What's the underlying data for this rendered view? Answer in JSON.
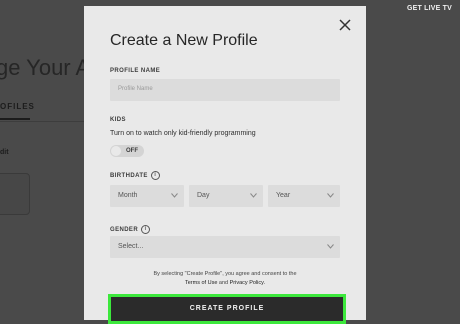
{
  "background": {
    "heading": "ge Your A",
    "tab_label": "OFILES",
    "edit_label": "dit",
    "live_tv": "GET LIVE TV"
  },
  "modal": {
    "title": "Create a New Profile",
    "profile_name": {
      "label": "PROFILE NAME",
      "placeholder": "Profile Name"
    },
    "kids": {
      "label": "KIDS",
      "description": "Turn on to watch only kid-friendly programming",
      "toggle_state": "OFF"
    },
    "birthdate": {
      "label": "BIRTHDATE",
      "month": "Month",
      "day": "Day",
      "year": "Year"
    },
    "gender": {
      "label": "GENDER",
      "value": "Select..."
    },
    "consent": {
      "prefix": "By selecting \"Create Profile\", you agree and consent to the",
      "terms": "Terms of Use",
      "and": "and",
      "privacy": "Privacy Policy."
    },
    "create_button": "CREATE PROFILE"
  }
}
